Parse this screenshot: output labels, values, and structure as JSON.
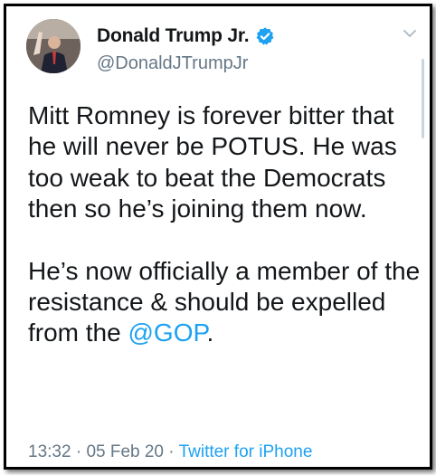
{
  "tweet": {
    "author": {
      "display_name": "Donald Trump Jr.",
      "handle": "@DonaldJTrumpJr",
      "verified_icon": "verified-badge-icon"
    },
    "paragraph1": "Mitt Romney is forever bitter that he will never be POTUS. He was too weak to beat the Democrats then so he’s joining them now.",
    "paragraph2_text": "He’s now officially a member of the resistance & should be expelled from the ",
    "paragraph2_mention": "@GOP",
    "paragraph2_end": ".",
    "time": "13:32",
    "separator1": " · ",
    "date": "05 Feb 20",
    "separator2": " · ",
    "source": "Twitter for iPhone"
  },
  "colors": {
    "text": "#14171a",
    "muted": "#657786",
    "link": "#1da1f2",
    "verified": "#1da1f2"
  },
  "icons": {
    "menu": "chevron-down-icon",
    "verified": "verified-badge-icon"
  }
}
